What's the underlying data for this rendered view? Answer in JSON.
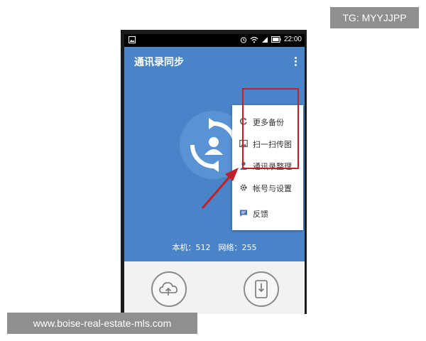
{
  "app": {
    "title": "通讯录同步",
    "time": "22:00"
  },
  "hero": {
    "counts_text": "本机：512　网络：255"
  },
  "menu": {
    "items": [
      {
        "label": "更多备份",
        "icon": "refresh-icon"
      },
      {
        "label": "扫一扫传图",
        "icon": "image-icon"
      },
      {
        "label": "通讯录整理",
        "icon": "person-icon"
      },
      {
        "label": "帐号与设置",
        "icon": "gear-icon"
      },
      {
        "label": "反馈",
        "icon": "chat-icon"
      }
    ]
  },
  "overlay": {
    "top_tag": "TG: MYYJJPP",
    "bottom_tag": "www.boise-real-estate-mls.com"
  },
  "colors": {
    "accent_blue": "#4a84c8",
    "highlight_red": "#c0202a"
  }
}
